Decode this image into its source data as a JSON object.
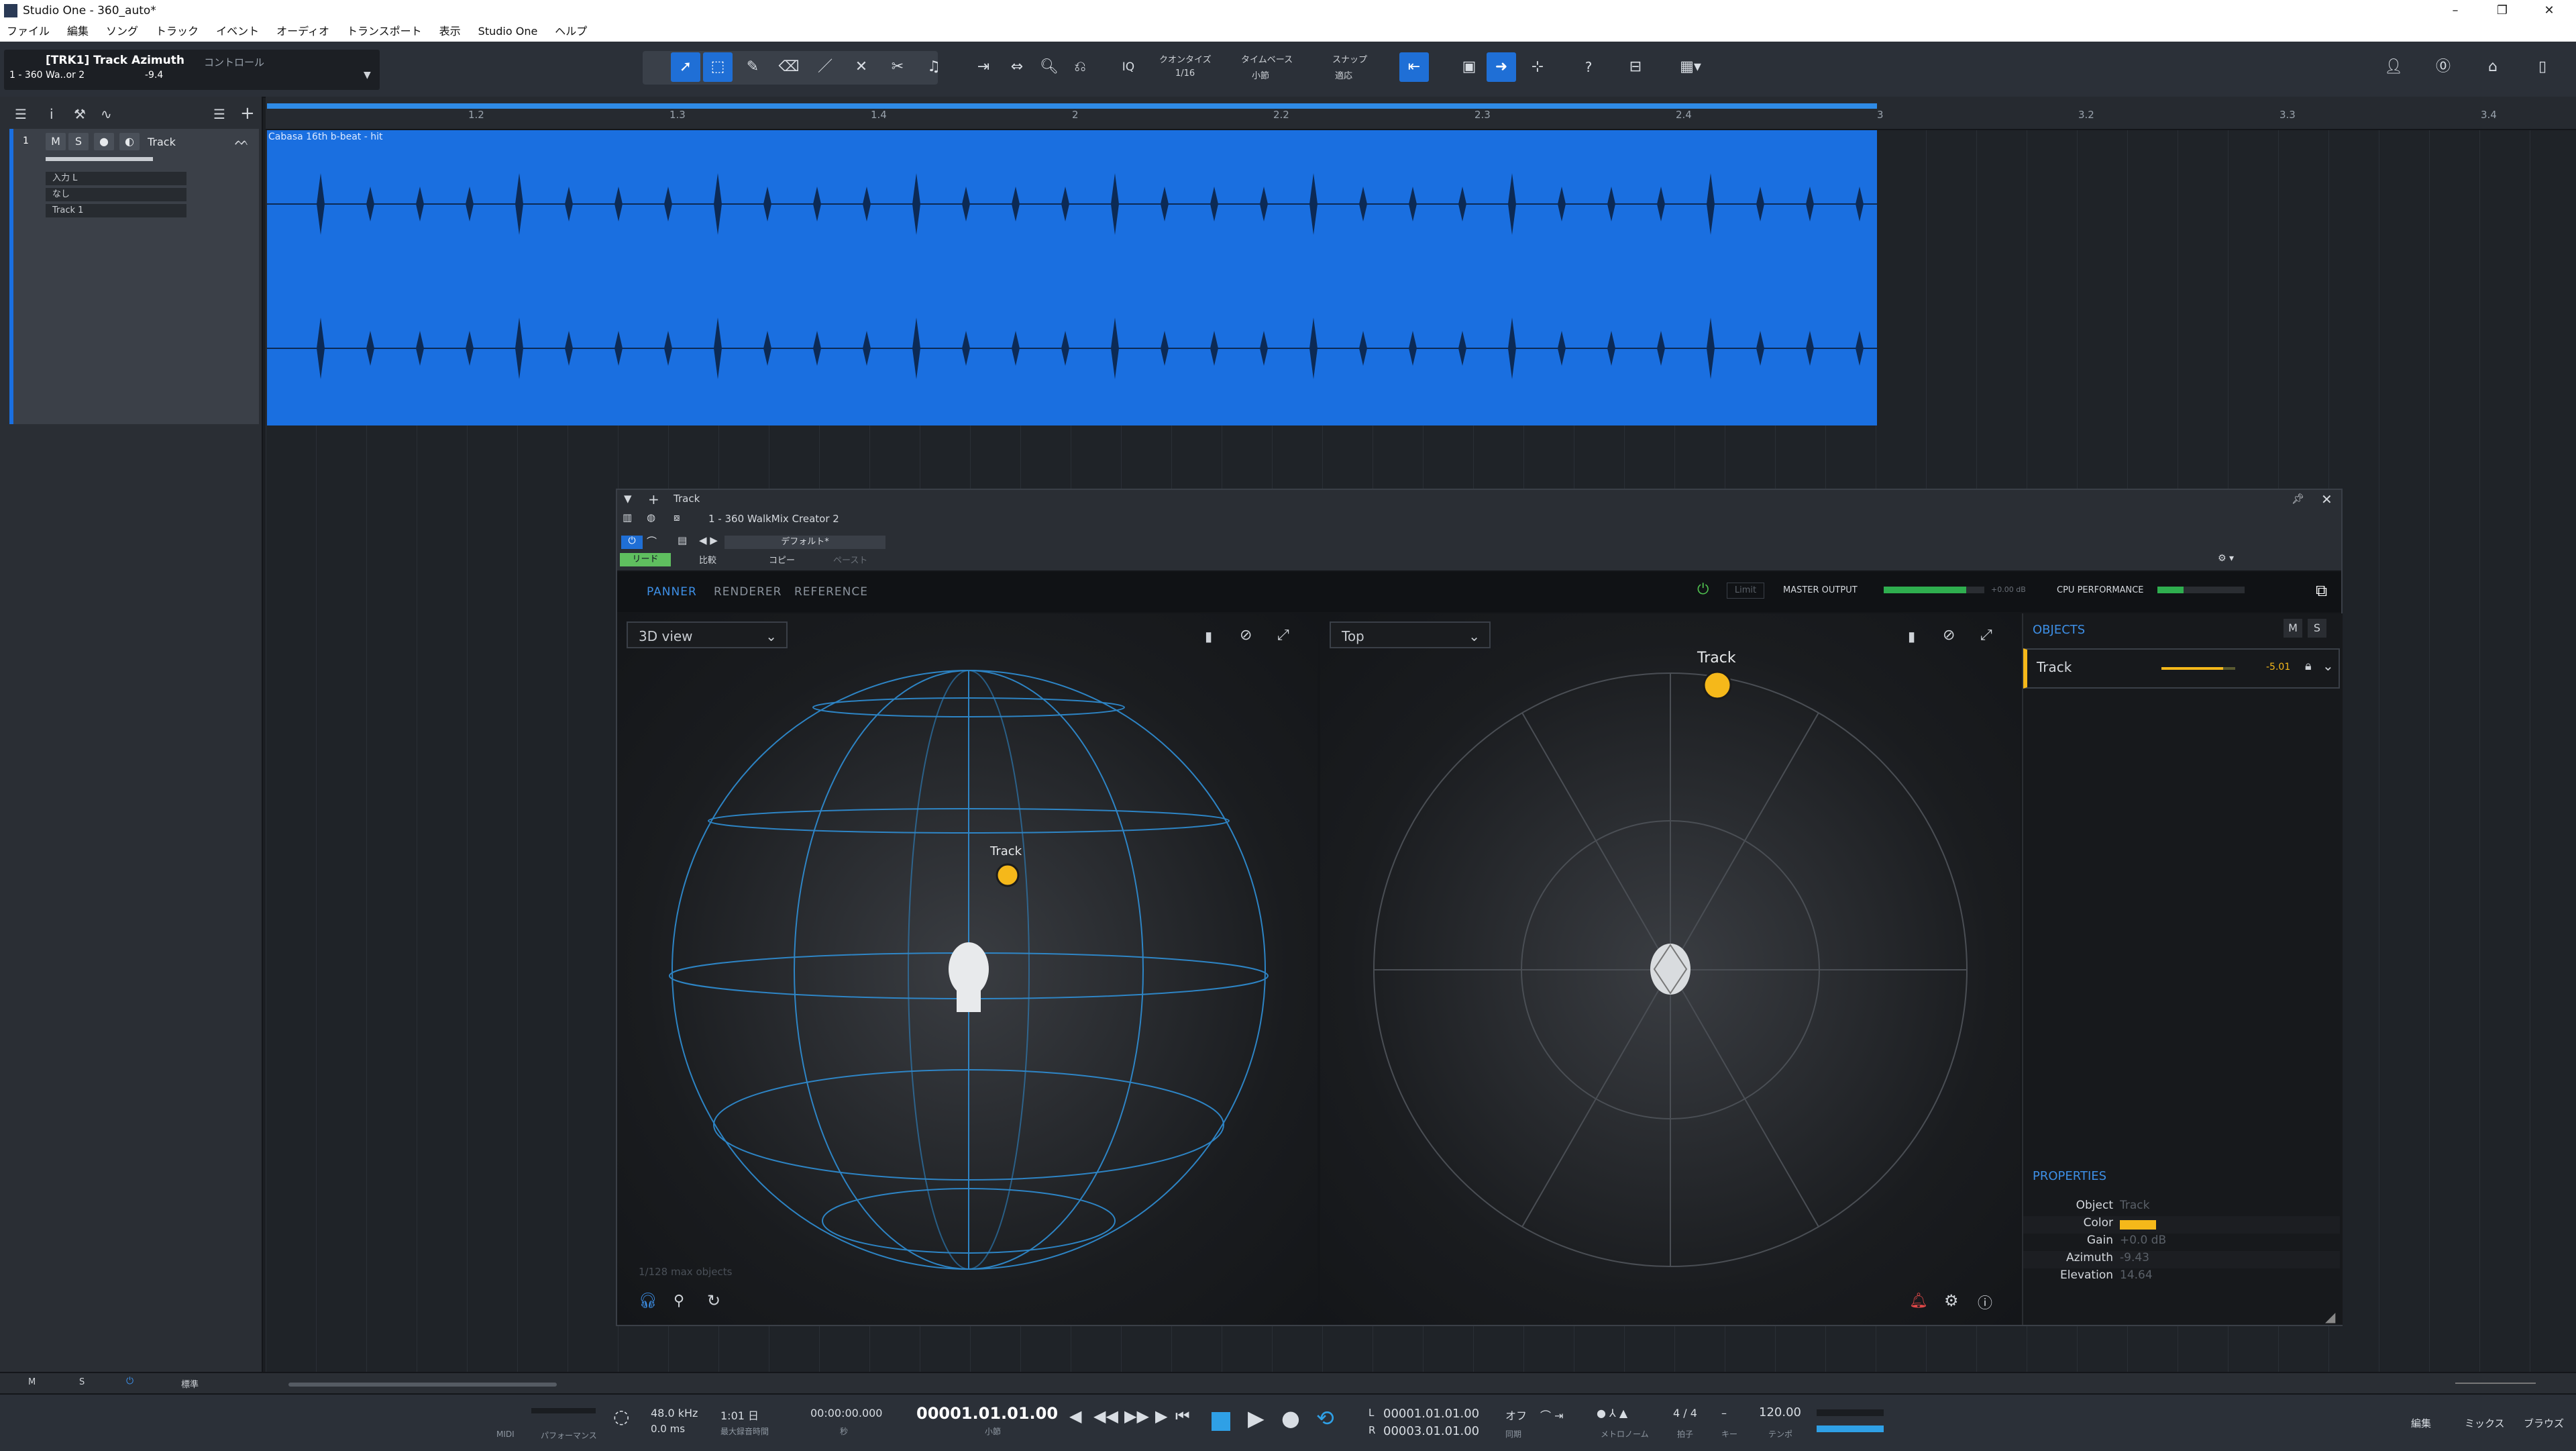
{
  "window": {
    "title": "Studio One - 360_auto*",
    "min": "–",
    "restore": "❐",
    "close": "✕"
  },
  "menu": [
    "ファイル",
    "編集",
    "ソング",
    "トラック",
    "イベント",
    "オーディオ",
    "トランスポート",
    "表示",
    "Studio One",
    "ヘルプ"
  ],
  "inspector": {
    "track_name": "[TRK1] Track Azimuth",
    "sub": "1 - 360 Wa..or 2",
    "value": "-9.4",
    "control": "コントロール"
  },
  "toolbar": {
    "iq": "IQ",
    "quantize_label": "クオンタイズ",
    "quantize_value": "1/16",
    "timebase_label": "タイムベース",
    "timebase_value": "小節",
    "snap_label": "スナップ",
    "snap_value": "適応",
    "help": "?"
  },
  "track": {
    "number": "1",
    "m": "M",
    "s": "S",
    "name": "Track",
    "input": "入力 L",
    "none": "なし",
    "output": "Track 1"
  },
  "ruler": {
    "ticks": [
      "1.2",
      "1.3",
      "1.4",
      "2",
      "2.2",
      "2.3",
      "2.4",
      "3",
      "3.2",
      "3.3",
      "3.4"
    ]
  },
  "clip": {
    "label": "Cabasa 16th b-beat - hit",
    "color": "#1a6fe0"
  },
  "plugin": {
    "window_title": "Track",
    "instance": "1 - 360 WalkMix Creator 2",
    "preset": "デフォルト*",
    "read": "リード",
    "compare": "比較",
    "copy": "コピー",
    "paste": "ペースト",
    "tabs": {
      "panner": "PANNER",
      "renderer": "RENDERER",
      "reference": "REFERENCE"
    },
    "limit": "Limit",
    "master_output": "MASTER OUTPUT",
    "master_value": "+0.00 dB",
    "cpu": "CPU PERFORMANCE",
    "view_left": "3D view",
    "view_right": "Top",
    "object_label": "Track",
    "max_objects": "1/128 max objects",
    "objects_title": "OBJECTS",
    "obj_m": "M",
    "obj_s": "S",
    "object_row": {
      "name": "Track",
      "gain": "-5.01"
    },
    "properties_title": "PROPERTIES",
    "properties": [
      {
        "label": "Object",
        "value": "Track"
      },
      {
        "label": "Color",
        "value": ""
      },
      {
        "label": "Gain",
        "value": "+0.0 dB"
      },
      {
        "label": "Azimuth",
        "value": "-9.43"
      },
      {
        "label": "Elevation",
        "value": "14.64"
      }
    ],
    "accent": "#3d8fe6",
    "object_color": "#f5b81a"
  },
  "bottom": {
    "m": "M",
    "s": "S",
    "mode": "標準"
  },
  "transport": {
    "midi": "MIDI",
    "performance": "パフォーマンス",
    "sample_rate": "48.0 kHz",
    "latency": "0.0 ms",
    "record_time": "1:01 日",
    "record_label": "最大録音時間",
    "seconds": "00:00:00.000",
    "seconds_label": "秒",
    "position": "00001.01.01.00",
    "position_label": "小節",
    "loop_l": "00001.01.01.00",
    "loop_r": "00003.01.01.00",
    "l": "L",
    "r": "R",
    "sync": "オフ",
    "sync_label": "同期",
    "metronome_label": "メトロノーム",
    "signature": "4 / 4",
    "signature_label": "拍子",
    "key_label": "キー",
    "tempo": "120.00",
    "tempo_label": "テンポ",
    "edit": "編集",
    "mix": "ミックス",
    "browse": "ブラウズ"
  }
}
